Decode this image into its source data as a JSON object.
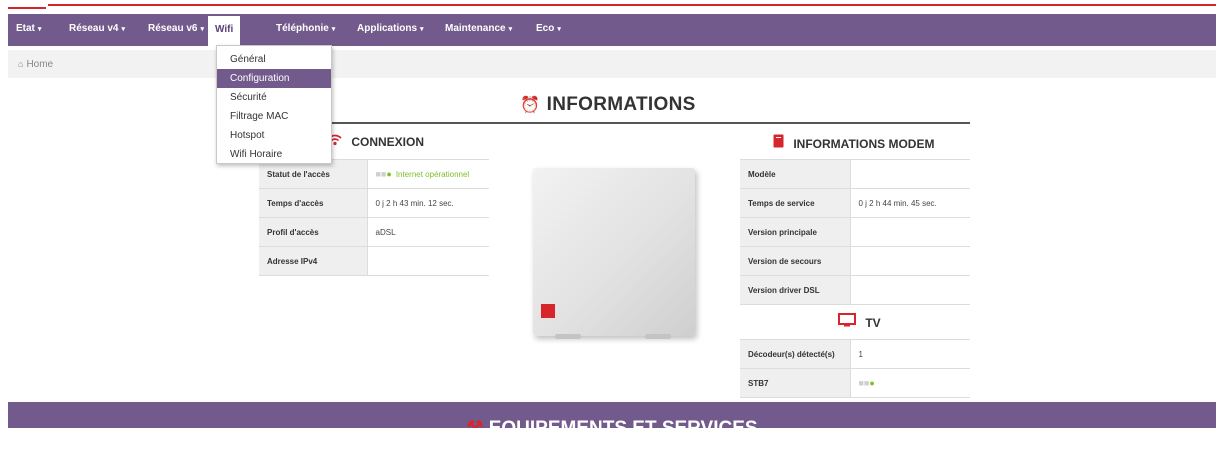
{
  "nav": {
    "items": [
      {
        "label": "Etat",
        "caret": "▾"
      },
      {
        "label": "Réseau v4",
        "caret": "▾"
      },
      {
        "label": "Réseau v6",
        "caret": "▾"
      },
      {
        "label": "Wifi",
        "caret": ""
      },
      {
        "label": "Téléphonie",
        "caret": "▾"
      },
      {
        "label": "Applications",
        "caret": "▾"
      },
      {
        "label": "Maintenance",
        "caret": "▾"
      },
      {
        "label": "Eco",
        "caret": "▾"
      }
    ],
    "active": "Wifi"
  },
  "wifi_menu": {
    "items": [
      "Général",
      "Configuration",
      "Sécurité",
      "Filtrage MAC",
      "Hotspot",
      "Wifi Horaire"
    ],
    "selected": "Configuration"
  },
  "breadcrumb": {
    "home": "Home"
  },
  "page_title": "INFORMATIONS",
  "connexion": {
    "title": "CONNEXION",
    "rows": [
      {
        "key": "Statut de l'accès",
        "value": "Internet opérationnel"
      },
      {
        "key": "Temps d'accès",
        "value": "0 j 2 h 43 min. 12 sec."
      },
      {
        "key": "Profil d'accès",
        "value": "aDSL"
      },
      {
        "key": "Adresse IPv4",
        "value": ""
      }
    ]
  },
  "modem_info": {
    "title": "INFORMATIONS MODEM",
    "rows": [
      {
        "key": "Modèle",
        "value": ""
      },
      {
        "key": "Temps de service",
        "value": "0 j 2 h 44 min. 45 sec."
      },
      {
        "key": "Version principale",
        "value": ""
      },
      {
        "key": "Version de secours",
        "value": ""
      },
      {
        "key": "Version driver DSL",
        "value": ""
      }
    ]
  },
  "tv": {
    "title": "TV",
    "rows": [
      {
        "key": "Décodeur(s) détecté(s)",
        "value": "1"
      },
      {
        "key": "STB7",
        "value": ""
      }
    ]
  },
  "footer_title": "EQUIPEMENTS ET SERVICES",
  "icons": {
    "page_title": "alarm-clock-icon",
    "connexion": "wifi-icon",
    "modem": "router-icon",
    "tv": "tv-icon",
    "home": "home-icon"
  },
  "colors": {
    "nav": "#735a8c",
    "accent": "#d6262b",
    "status_ok": "#7fbf28"
  }
}
